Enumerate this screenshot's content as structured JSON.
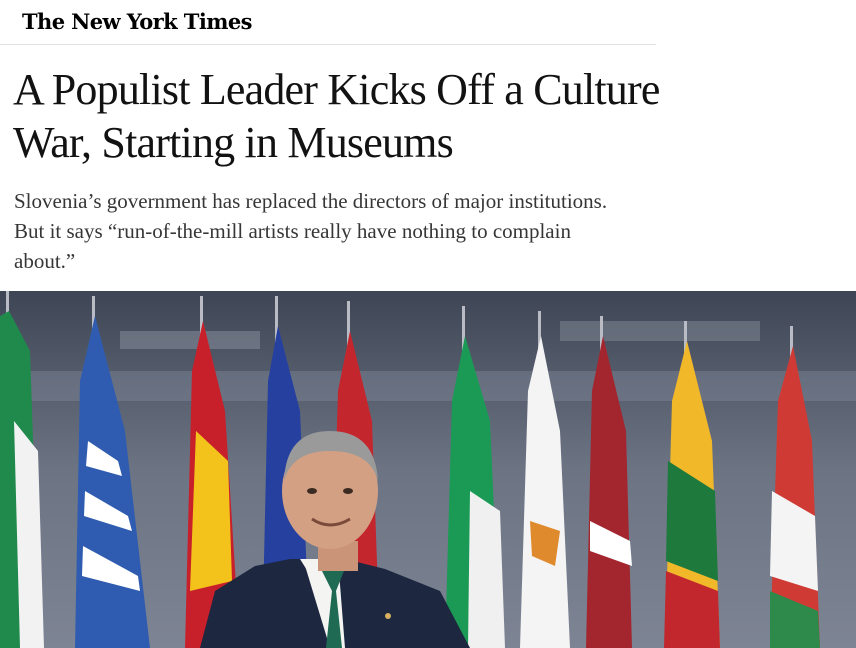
{
  "masthead": {
    "logo": "The New York Times"
  },
  "article": {
    "headline": "A Populist Leader Kicks Off a Culture War, Starting in Museums",
    "summary": "Slovenia’s government has replaced the directors of major institutions. But it says “run-of-the-mill artists really have nothing to complain about.”"
  },
  "photo": {
    "subject": "man in suit smiling in front of row of flags"
  },
  "colors": {
    "text": "#121212",
    "summary_text": "#363636",
    "divider": "#e2e2e2"
  }
}
